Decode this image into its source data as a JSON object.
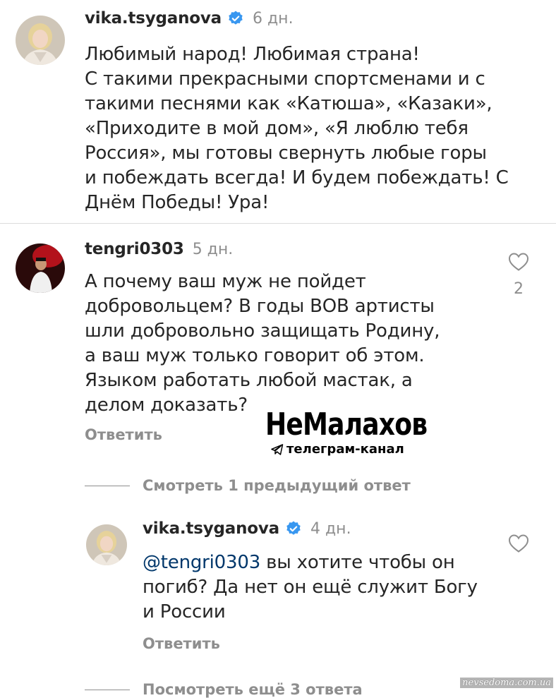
{
  "comments": [
    {
      "username": "vika.tsyganova",
      "verified": true,
      "time": "6 дн.",
      "text": "Любимый народ! Любимая страна!\nС такими прекрасными спортсменами и с\nтакими песнями как «Катюша», «Казаки»,\n«Приходите в мой дом», «Я люблю тебя\nРоссия», мы готовы свернуть любые горы\nи побеждать всегда! И будем побеждать! С\nДнём Победы! Ура!",
      "avatar_icon": "woman-portrait-avatar"
    },
    {
      "username": "tengri0303",
      "verified": false,
      "time": "5 дн.",
      "text": "А  почему ваш муж не пойдет\nдобровольцем? В годы ВОВ артисты\nшли добровольно защищать Родину,\nа ваш муж только говорит об этом.\nЯзыком работать любой мастак, а\nделом доказать?",
      "reply_label": "Ответить",
      "likes": "2",
      "avatar_icon": "man-portrait-avatar"
    }
  ],
  "view_replies": {
    "previous": "Смотреть 1 предыдущий ответ",
    "more": "Посмотреть ещё 3 ответа"
  },
  "reply": {
    "username": "vika.tsyganova",
    "verified": true,
    "time": "4 дн.",
    "mention": "@tengri0303",
    "text": " вы хотите чтобы он\nпогиб? Да нет он ещё служит Богу\nи России",
    "reply_label": "Ответить",
    "avatar_icon": "woman-portrait-avatar"
  },
  "watermark": {
    "title": "НеМалахов",
    "subtitle": "телеграм-канал",
    "site": "nevsedoma.com.ua"
  },
  "colors": {
    "text": "#262626",
    "secondary": "#8e8e8e",
    "mention": "#00376b",
    "verified": "#3897f0",
    "divider": "#dbdbdb"
  }
}
